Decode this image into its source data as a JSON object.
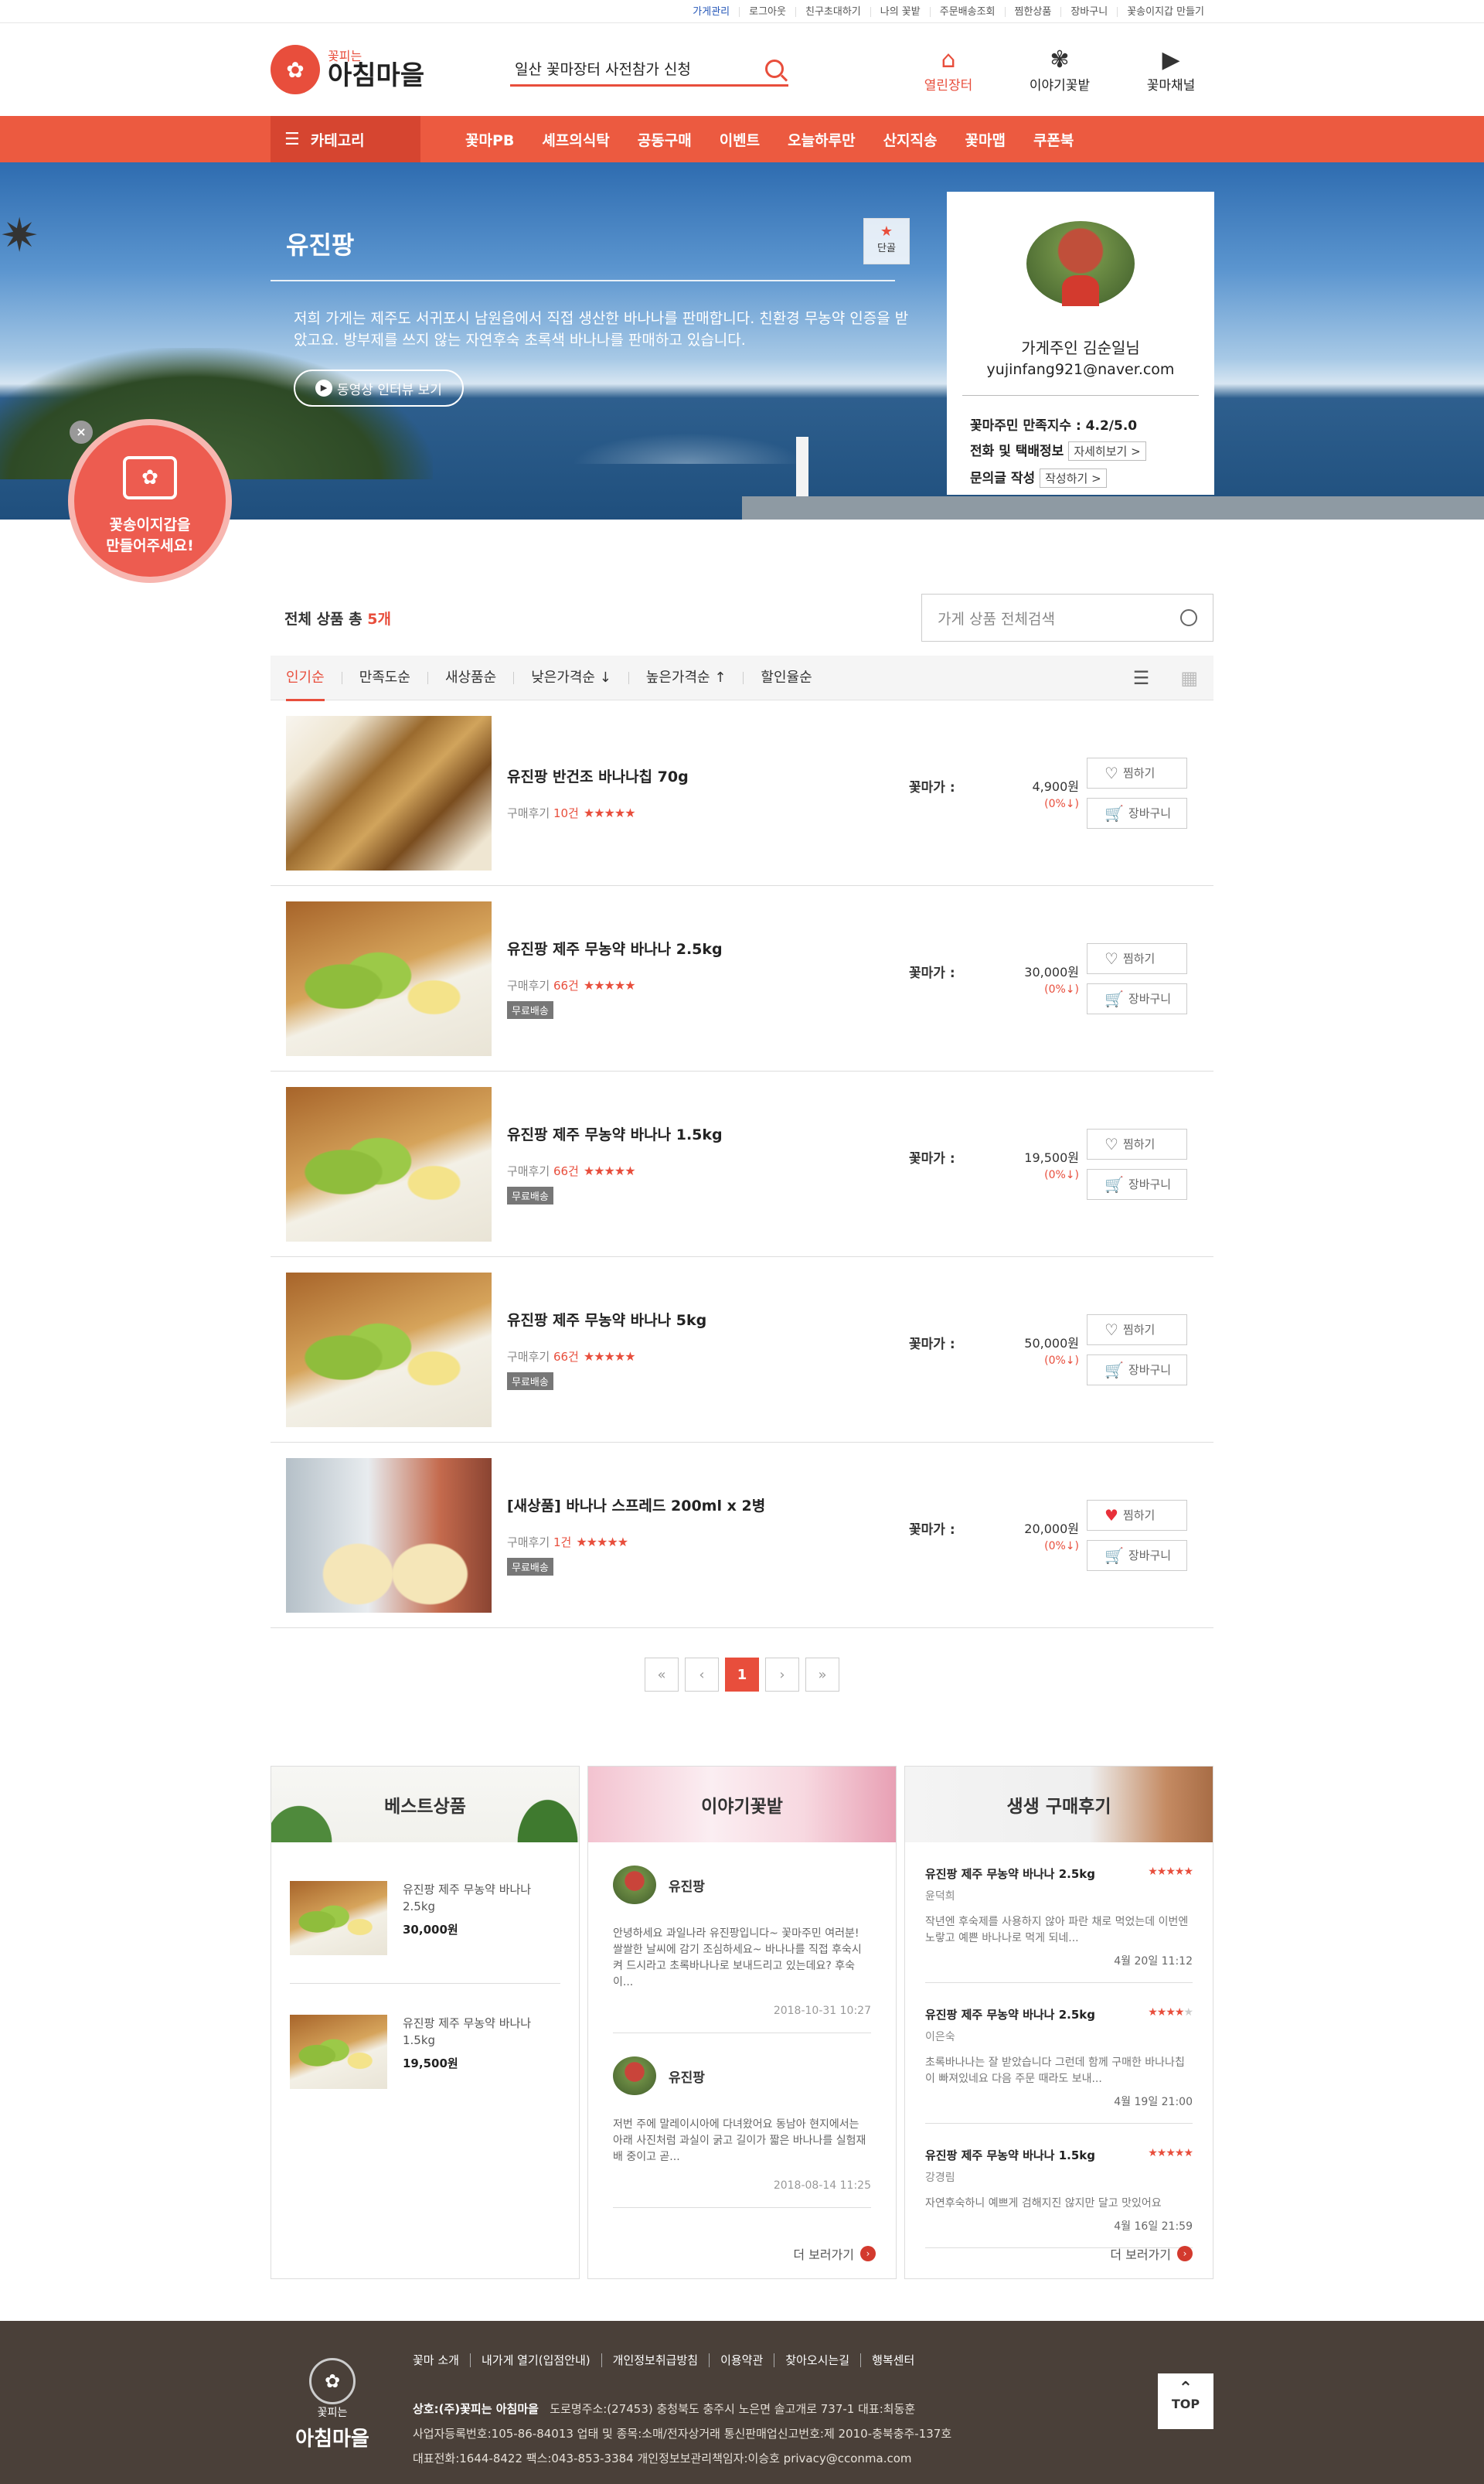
{
  "util": {
    "links": [
      "가게관리",
      "로그아웃",
      "친구초대하기",
      "나의 꽃밭",
      "주문배송조회",
      "찜한상품",
      "장바구니",
      "꽃송이지갑 만들기"
    ]
  },
  "header": {
    "logo_small": "꽃피는",
    "logo_big": "아침마을",
    "search_text": "일산 꽃마장터 사전참가 신청",
    "quick": [
      {
        "label": "열린장터",
        "icon": "basket-icon"
      },
      {
        "label": "이야기꽃밭",
        "icon": "flowers-icon"
      },
      {
        "label": "꽃마채널",
        "icon": "tv-play-icon"
      }
    ]
  },
  "gnb": {
    "category": "카테고리",
    "menu": [
      "꽃마PB",
      "셰프의식탁",
      "공동구매",
      "이벤트",
      "오늘하루만",
      "산지직송",
      "꽃마맵",
      "쿠폰북"
    ]
  },
  "shop": {
    "name": "유진팡",
    "fav_label": "단골",
    "desc": "저희 가게는 제주도 서귀포시 남원읍에서 직접 생산한 바나나를 판매합니다. 친환경 무농약 인증을 받았고요. 방부제를 쓰지 않는 자연후숙 초록색 바나나를 판매하고 있습니다.",
    "video_btn": "동영상 인터뷰 보기",
    "owner_name": "가게주인 김순일님",
    "owner_email": "yujinfang921@naver.com",
    "stats": [
      {
        "label": "꽃마주민 만족지수 : 4.2/5.0",
        "btn": ""
      },
      {
        "label": "전화 및 택배정보",
        "btn": "자세히보기 >"
      },
      {
        "label": "문의글 작성",
        "btn": "작성하기 >"
      }
    ]
  },
  "wallet": {
    "line1": "꽃송이지갑을",
    "line2": "만들어주세요!",
    "close": "×"
  },
  "list": {
    "total_label": "전체 상품 총 ",
    "total_count": "5개",
    "search_placeholder": "가게 상품 전체검색",
    "sorts": [
      "인기순",
      "만족도순",
      "새상품순",
      "낮은가격순 ↓",
      "높은가격순 ↑",
      "할인율순"
    ],
    "price_label": "꽃마가 :",
    "review_prefix": "구매후기 ",
    "free_ship": "무료배송",
    "wish_label": "찜하기",
    "cart_label": "장바구니",
    "items": [
      {
        "name": "유진팡 반건조 바나나칩 70g",
        "reviews": "10건",
        "price": "4,900원",
        "discount": "(0%↓)",
        "free": false,
        "img": "t-chip",
        "wished": false,
        "stars": 4.5
      },
      {
        "name": "유진팡 제주 무농약 바나나 2.5kg",
        "reviews": "66건",
        "price": "30,000원",
        "discount": "(0%↓)",
        "free": true,
        "img": "t-banana",
        "wished": false,
        "stars": 4.5
      },
      {
        "name": "유진팡 제주 무농약 바나나 1.5kg",
        "reviews": "66건",
        "price": "19,500원",
        "discount": "(0%↓)",
        "free": true,
        "img": "t-banana",
        "wished": false,
        "stars": 4.5
      },
      {
        "name": "유진팡 제주 무농약 바나나 5kg",
        "reviews": "66건",
        "price": "50,000원",
        "discount": "(0%↓)",
        "free": true,
        "img": "t-banana",
        "wished": false,
        "stars": 4.5
      },
      {
        "name": "[새상품] 바나나 스프레드 200ml x 2병",
        "reviews": "1건",
        "price": "20,000원",
        "discount": "(0%↓)",
        "free": true,
        "img": "t-jar",
        "wished": true,
        "stars": 5
      }
    ]
  },
  "pager": {
    "first": "«",
    "prev": "‹",
    "current": "1",
    "next": "›",
    "last": "»"
  },
  "best": {
    "title": "베스트상품",
    "items": [
      {
        "name": "유진팡 제주 무농약 바나나 2.5kg",
        "price": "30,000원"
      },
      {
        "name": "유진팡 제주 무농약 바나나 1.5kg",
        "price": "19,500원"
      }
    ]
  },
  "story": {
    "title": "이야기꽃밭",
    "more": "더 보러가기",
    "items": [
      {
        "author": "유진팡",
        "text": "안녕하세요 과일나라 유진팡입니다~ 꽃마주민 여러분! 쌀쌀한 날씨에 감기 조심하세요~ 바나나를 직접 후숙시켜 드시라고 초록바나나로 보내드리고 있는데요? 후숙이...",
        "date": "2018-10-31 10:27"
      },
      {
        "author": "유진팡",
        "text": "저번 주에 말레이시아에 다녀왔어요 동남아 현지에서는 아래 사진처럼 과실이 굵고 길이가 짧은 바나나를 실험재배 중이고 곧...",
        "date": "2018-08-14 11:25"
      }
    ]
  },
  "reviews": {
    "title": "생생 구매후기",
    "more": "더 보러가기",
    "items": [
      {
        "product": "유진팡 제주 무농약 바나나 2.5kg",
        "author": "윤덕희",
        "text": "작년엔 후숙제를 사용하지 않아 파란 채로 먹었는데 이번엔 노랗고 예쁜 바나나로 먹게 되네...",
        "date": "4월 20일 11:12",
        "stars": 5
      },
      {
        "product": "유진팡 제주 무농약 바나나 2.5kg",
        "author": "이은숙",
        "text": "초록바나나는 잘 받았습니다 그런데 함께 구매한 바나나칩이 빠져있네요 다음 주문 때라도 보내...",
        "date": "4월 19일 21:00",
        "stars": 4
      },
      {
        "product": "유진팡 제주 무농약 바나나 1.5kg",
        "author": "강경림",
        "text": "자연후숙하니 예쁘게 검해지진 않지만 달고 맛있어요",
        "date": "4월 16일 21:59",
        "stars": 5
      }
    ]
  },
  "footer": {
    "logo_small": "꽃피는",
    "logo_big": "아침마을",
    "links": [
      "꽃마 소개",
      "내가게 열기(입점안내)",
      "개인정보취급방침",
      "이용약관",
      "찾아오시는길",
      "행복센터"
    ],
    "line1_company": "상호:(주)꽃피는 아침마을",
    "line1_rest": "도로명주소:(27453) 충청북도 충주시 노은면 솔고개로 737-1    대표:최동훈",
    "line2": "사업자등록번호:105-86-84013    업태 및 종목:소매/전자상거래    통신판매업신고번호:제 2010-충북충주-137호",
    "line3": "대표전화:1644-8422    팩스:043-853-3384    개인정보보관리책임자:이승호  privacy@cconma.com",
    "top": "TOP"
  }
}
